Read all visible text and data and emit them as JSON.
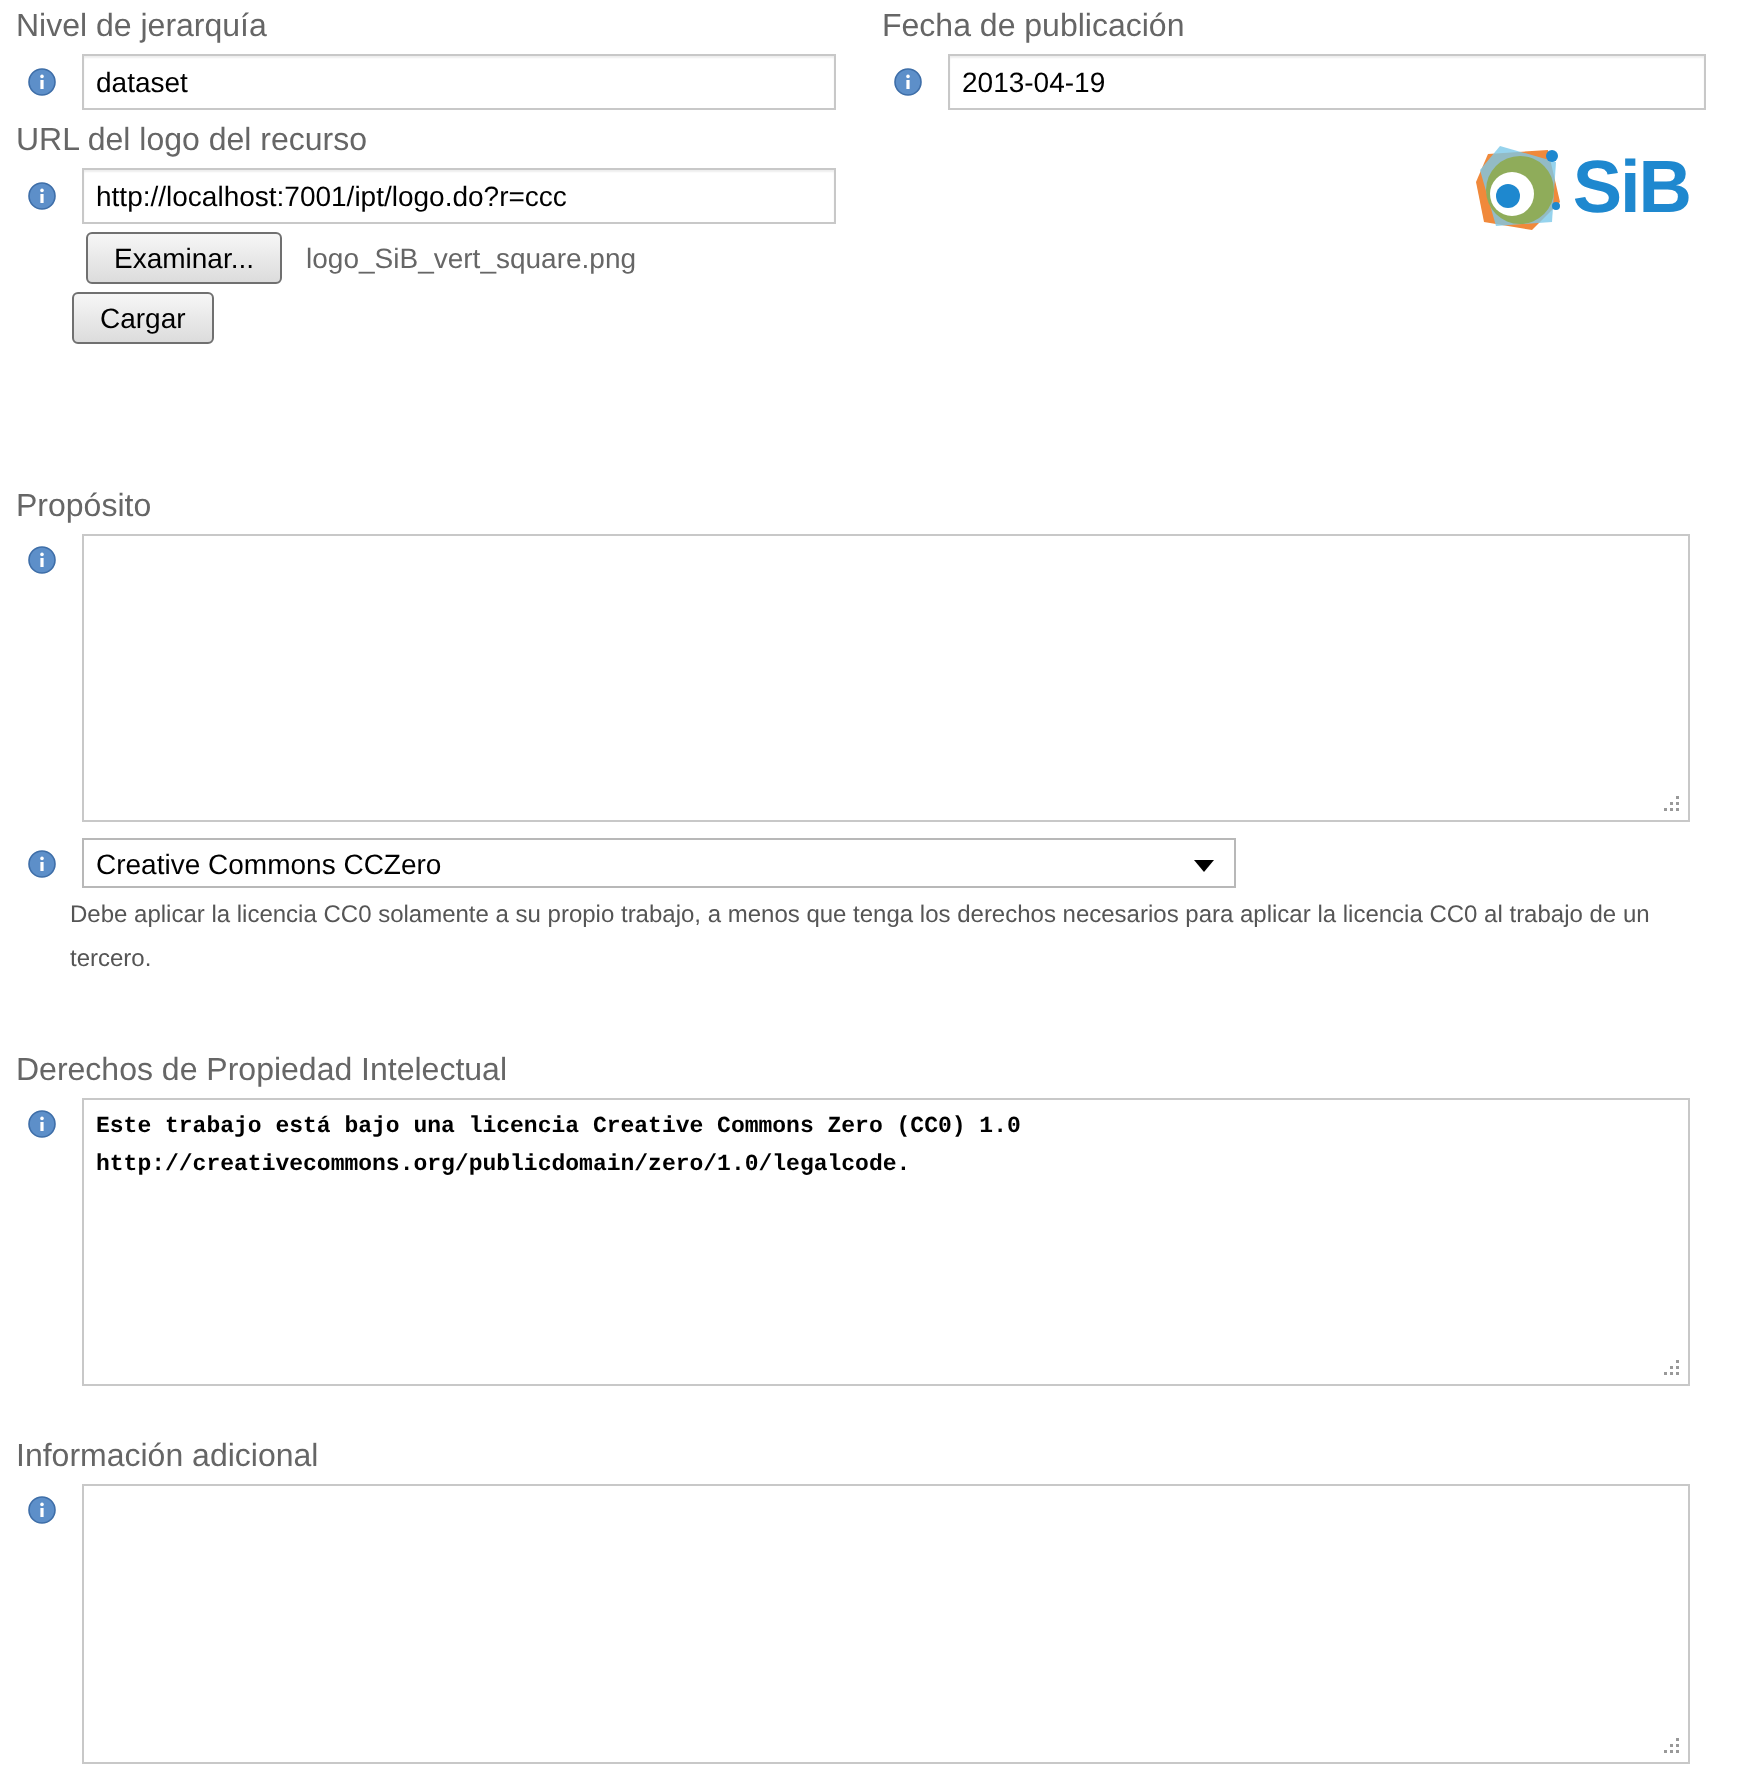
{
  "fields_top": [
    {
      "label": "Nivel de jerarquía",
      "value": "dataset"
    },
    {
      "label": "Fecha de publicación",
      "value": "2013-04-19"
    }
  ],
  "logo": {
    "label": "URL del logo del recurso",
    "value": "http://localhost:7001/ipt/logo.do?r=ccc",
    "browse_button": "Examinar...",
    "file_name": "logo_SiB_vert_square.png",
    "upload_button": "Cargar",
    "logo_text": "SiB"
  },
  "purpose": {
    "label": "Propósito"
  },
  "license": {
    "value": "Creative Commons CCZero",
    "help": "Debe aplicar la licencia CC0 solamente a su propio trabajo, a menos que tenga los derechos necesarios para aplicar la licencia CC0 al trabajo de un tercero."
  },
  "rights": {
    "label": "Derechos de Propiedad Intelectual",
    "value": "Este trabajo está bajo una licencia Creative Commons Zero (CC0) 1.0\nhttp://creativecommons.org/publicdomain/zero/1.0/legalcode."
  },
  "additional": {
    "label": "Información adicional"
  }
}
